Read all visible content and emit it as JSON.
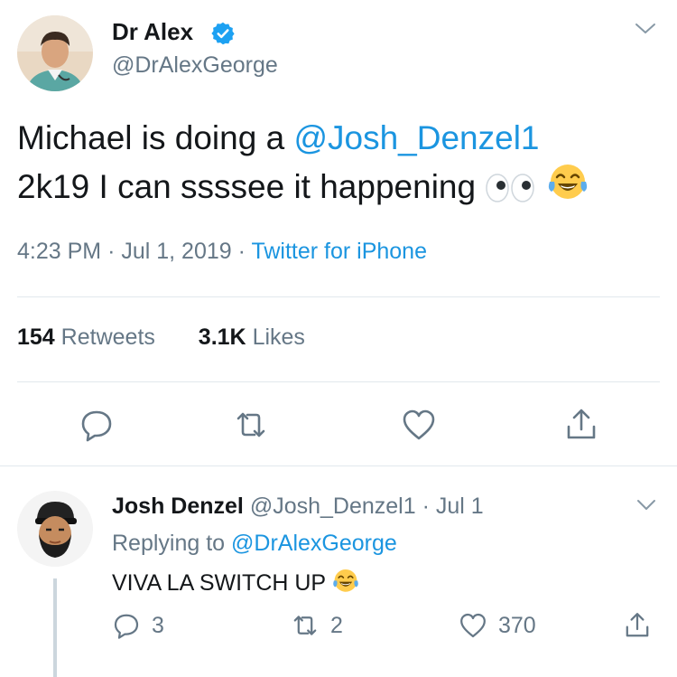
{
  "tweet": {
    "author_name": "Dr Alex",
    "author_handle": "@DrAlexGeorge",
    "text_line1_pre": "Michael is doing a ",
    "text_mention": "@Josh_Denzel1",
    "text_line2": "2k19 I can ssssee it happening",
    "time": "4:23 PM",
    "date": "Jul 1, 2019",
    "source": "Twitter for iPhone",
    "retweets_count": "154",
    "retweets_label": "Retweets",
    "likes_count": "3.1K",
    "likes_label": "Likes",
    "emojis": [
      "eyes-emoji",
      "tears-of-joy-emoji"
    ]
  },
  "actions": [
    "reply-icon",
    "retweet-icon",
    "like-icon",
    "share-icon"
  ],
  "reply": {
    "author_name": "Josh Denzel",
    "author_handle": "@Josh_Denzel1",
    "date": "Jul 1",
    "replying_prefix": "Replying to",
    "replying_handle": "@DrAlexGeorge",
    "text": "VIVA LA SWITCH UP",
    "reply_count": "3",
    "retweet_count": "2",
    "like_count": "370"
  },
  "colors": {
    "link": "#1b95e0",
    "muted": "#657786",
    "divider": "#e1e8ed",
    "verified": "#1da1f2"
  }
}
